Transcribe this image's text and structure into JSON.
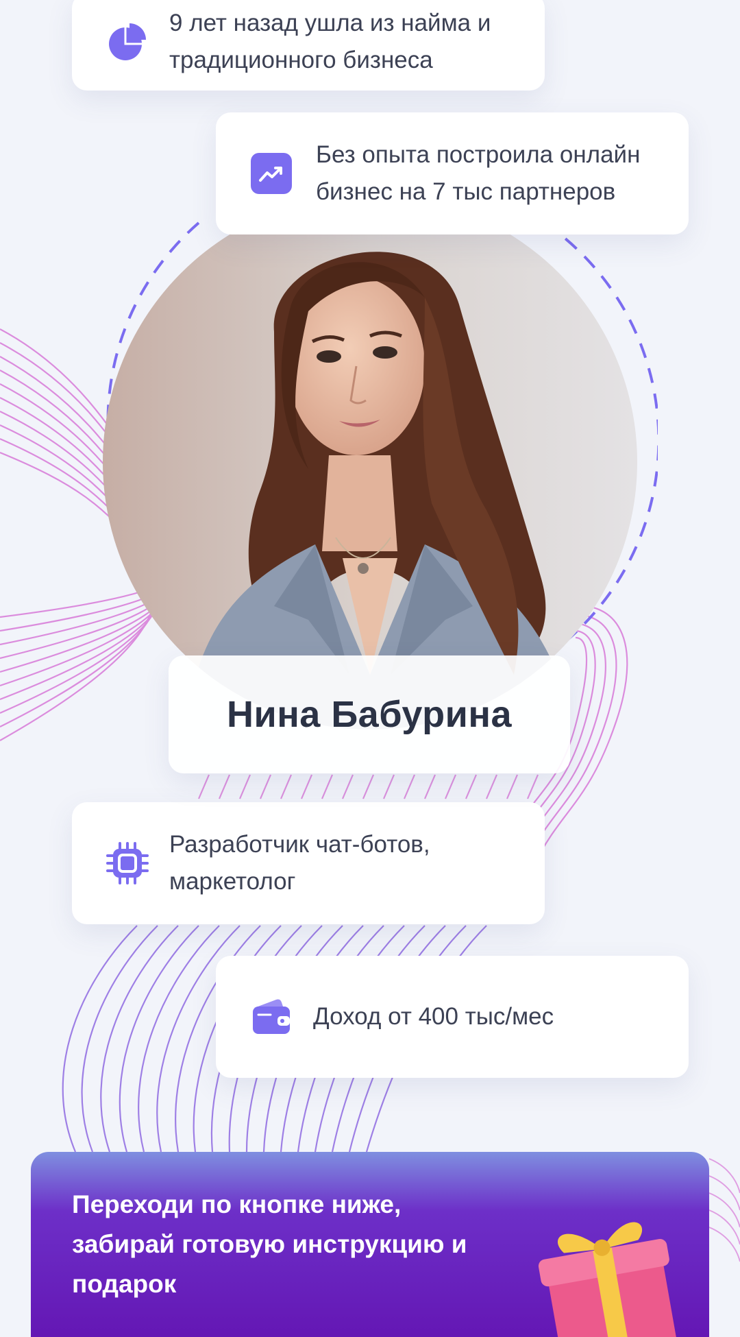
{
  "cards": [
    {
      "text": "9 лет назад ушла из найма и традиционного бизнеса",
      "icon": "pie-chart-icon"
    },
    {
      "text": "Без опыта построила онлайн бизнес на 7 тыс партнеров",
      "icon": "trending-up-icon"
    },
    {
      "text": "Разработчик чат-ботов, маркетолог",
      "icon": "chip-icon"
    },
    {
      "text": "Доход от 400 тыс/мес",
      "icon": "wallet-icon"
    }
  ],
  "profile": {
    "name": "Нина Бабурина"
  },
  "cta": {
    "text": "Переходи по кнопке ниже, забирай готовую инструкцию и подарок",
    "icon": "gift-icon"
  },
  "colors": {
    "accent": "#7b6cf0",
    "lines_pink": "#d27ad8",
    "lines_purple": "#8a63e0",
    "cta_top": "#7f8fe0",
    "cta_bottom": "#6417b4"
  }
}
